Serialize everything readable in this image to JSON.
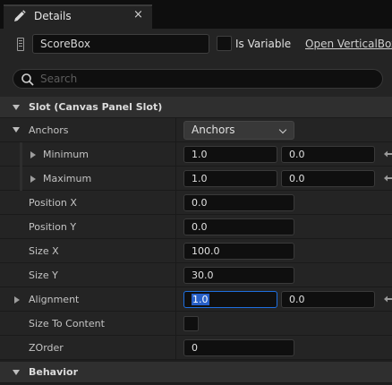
{
  "tab": {
    "title": "Details",
    "close_glyph": "×",
    "icon": "pencil-icon"
  },
  "header": {
    "widget_name": "ScoreBox",
    "is_variable_label": "Is Variable",
    "is_variable_checked": false,
    "open_link": "Open VerticalBox",
    "search_placeholder": "Search"
  },
  "slot": {
    "category": "Slot (Canvas Panel Slot)",
    "anchors": {
      "label": "Anchors",
      "preset": "Anchors",
      "minimum": {
        "label": "Minimum",
        "x": "1.0",
        "y": "0.0"
      },
      "maximum": {
        "label": "Maximum",
        "x": "1.0",
        "y": "0.0"
      }
    },
    "position_x": {
      "label": "Position X",
      "value": "0.0"
    },
    "position_y": {
      "label": "Position Y",
      "value": "0.0"
    },
    "size_x": {
      "label": "Size X",
      "value": "100.0"
    },
    "size_y": {
      "label": "Size Y",
      "value": "30.0"
    },
    "alignment": {
      "label": "Alignment",
      "x": "1.0",
      "y": "0.0"
    },
    "size_to_content": {
      "label": "Size To Content",
      "checked": false
    },
    "zorder": {
      "label": "ZOrder",
      "value": "0"
    }
  },
  "behavior": {
    "category": "Behavior"
  },
  "colors": {
    "background": "#242424",
    "input": "#0f0f0f",
    "focus": "#1e6fe0",
    "selection": "#2860c8"
  }
}
